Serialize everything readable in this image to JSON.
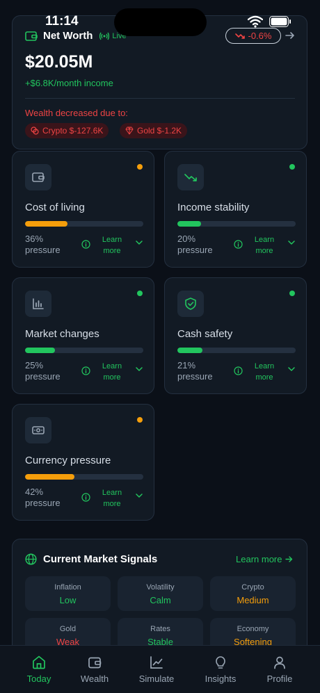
{
  "status_bar": {
    "time": "11:14"
  },
  "net_worth": {
    "title": "Net Worth",
    "live_label": "Live",
    "change": "-0.6%",
    "value": "$20.05M",
    "income": "+$6.8K/month income",
    "decrease_label": "Wealth decreased due to:",
    "chips": [
      {
        "icon": "coins-icon",
        "text": "Crypto $-127.6K"
      },
      {
        "icon": "gem-icon",
        "text": "Gold $-1.2K"
      }
    ]
  },
  "factors": [
    {
      "name": "cost-of-living",
      "icon": "wallet-icon",
      "title": "Cost of living",
      "pressure": 36,
      "pct_label": "36%",
      "pressure_word": "pressure",
      "learn": "Learn",
      "more": "more",
      "status_color": "#f59e0b"
    },
    {
      "name": "income-stability",
      "icon": "trending-down-icon",
      "title": "Income stability",
      "pressure": 20,
      "pct_label": "20%",
      "pressure_word": "pressure",
      "learn": "Learn",
      "more": "more",
      "status_color": "#22c55e"
    },
    {
      "name": "market-changes",
      "icon": "bar-chart-icon",
      "title": "Market changes",
      "pressure": 25,
      "pct_label": "25%",
      "pressure_word": "pressure",
      "learn": "Learn",
      "more": "more",
      "status_color": "#22c55e"
    },
    {
      "name": "cash-safety",
      "icon": "shield-check-icon",
      "title": "Cash safety",
      "pressure": 21,
      "pct_label": "21%",
      "pressure_word": "pressure",
      "learn": "Learn",
      "more": "more",
      "status_color": "#22c55e"
    },
    {
      "name": "currency-pressure",
      "icon": "banknote-icon",
      "title": "Currency pressure",
      "pressure": 42,
      "pct_label": "42%",
      "pressure_word": "pressure",
      "learn": "Learn",
      "more": "more",
      "status_color": "#f59e0b"
    }
  ],
  "market_signals": {
    "title": "Current Market Signals",
    "link": "Learn more",
    "items": [
      {
        "label": "Inflation",
        "value": "Low",
        "color": "#22c55e"
      },
      {
        "label": "Volatility",
        "value": "Calm",
        "color": "#22c55e"
      },
      {
        "label": "Crypto",
        "value": "Medium",
        "color": "#f59e0b"
      },
      {
        "label": "Gold",
        "value": "Weak",
        "color": "#ef4444"
      },
      {
        "label": "Rates",
        "value": "Stable",
        "color": "#22c55e"
      },
      {
        "label": "Economy",
        "value": "Softening",
        "color": "#f59e0b"
      }
    ]
  },
  "nav": {
    "items": [
      {
        "label": "Today",
        "icon": "home-icon",
        "active": true
      },
      {
        "label": "Wealth",
        "icon": "wallet-icon",
        "active": false
      },
      {
        "label": "Simulate",
        "icon": "line-chart-icon",
        "active": false
      },
      {
        "label": "Insights",
        "icon": "lightbulb-icon",
        "active": false
      },
      {
        "label": "Profile",
        "icon": "user-icon",
        "active": false
      }
    ]
  },
  "colors": {
    "accent": "#22c55e",
    "warning": "#f59e0b",
    "danger": "#ef4444",
    "background": "#0b1018",
    "card": "#121a24"
  }
}
